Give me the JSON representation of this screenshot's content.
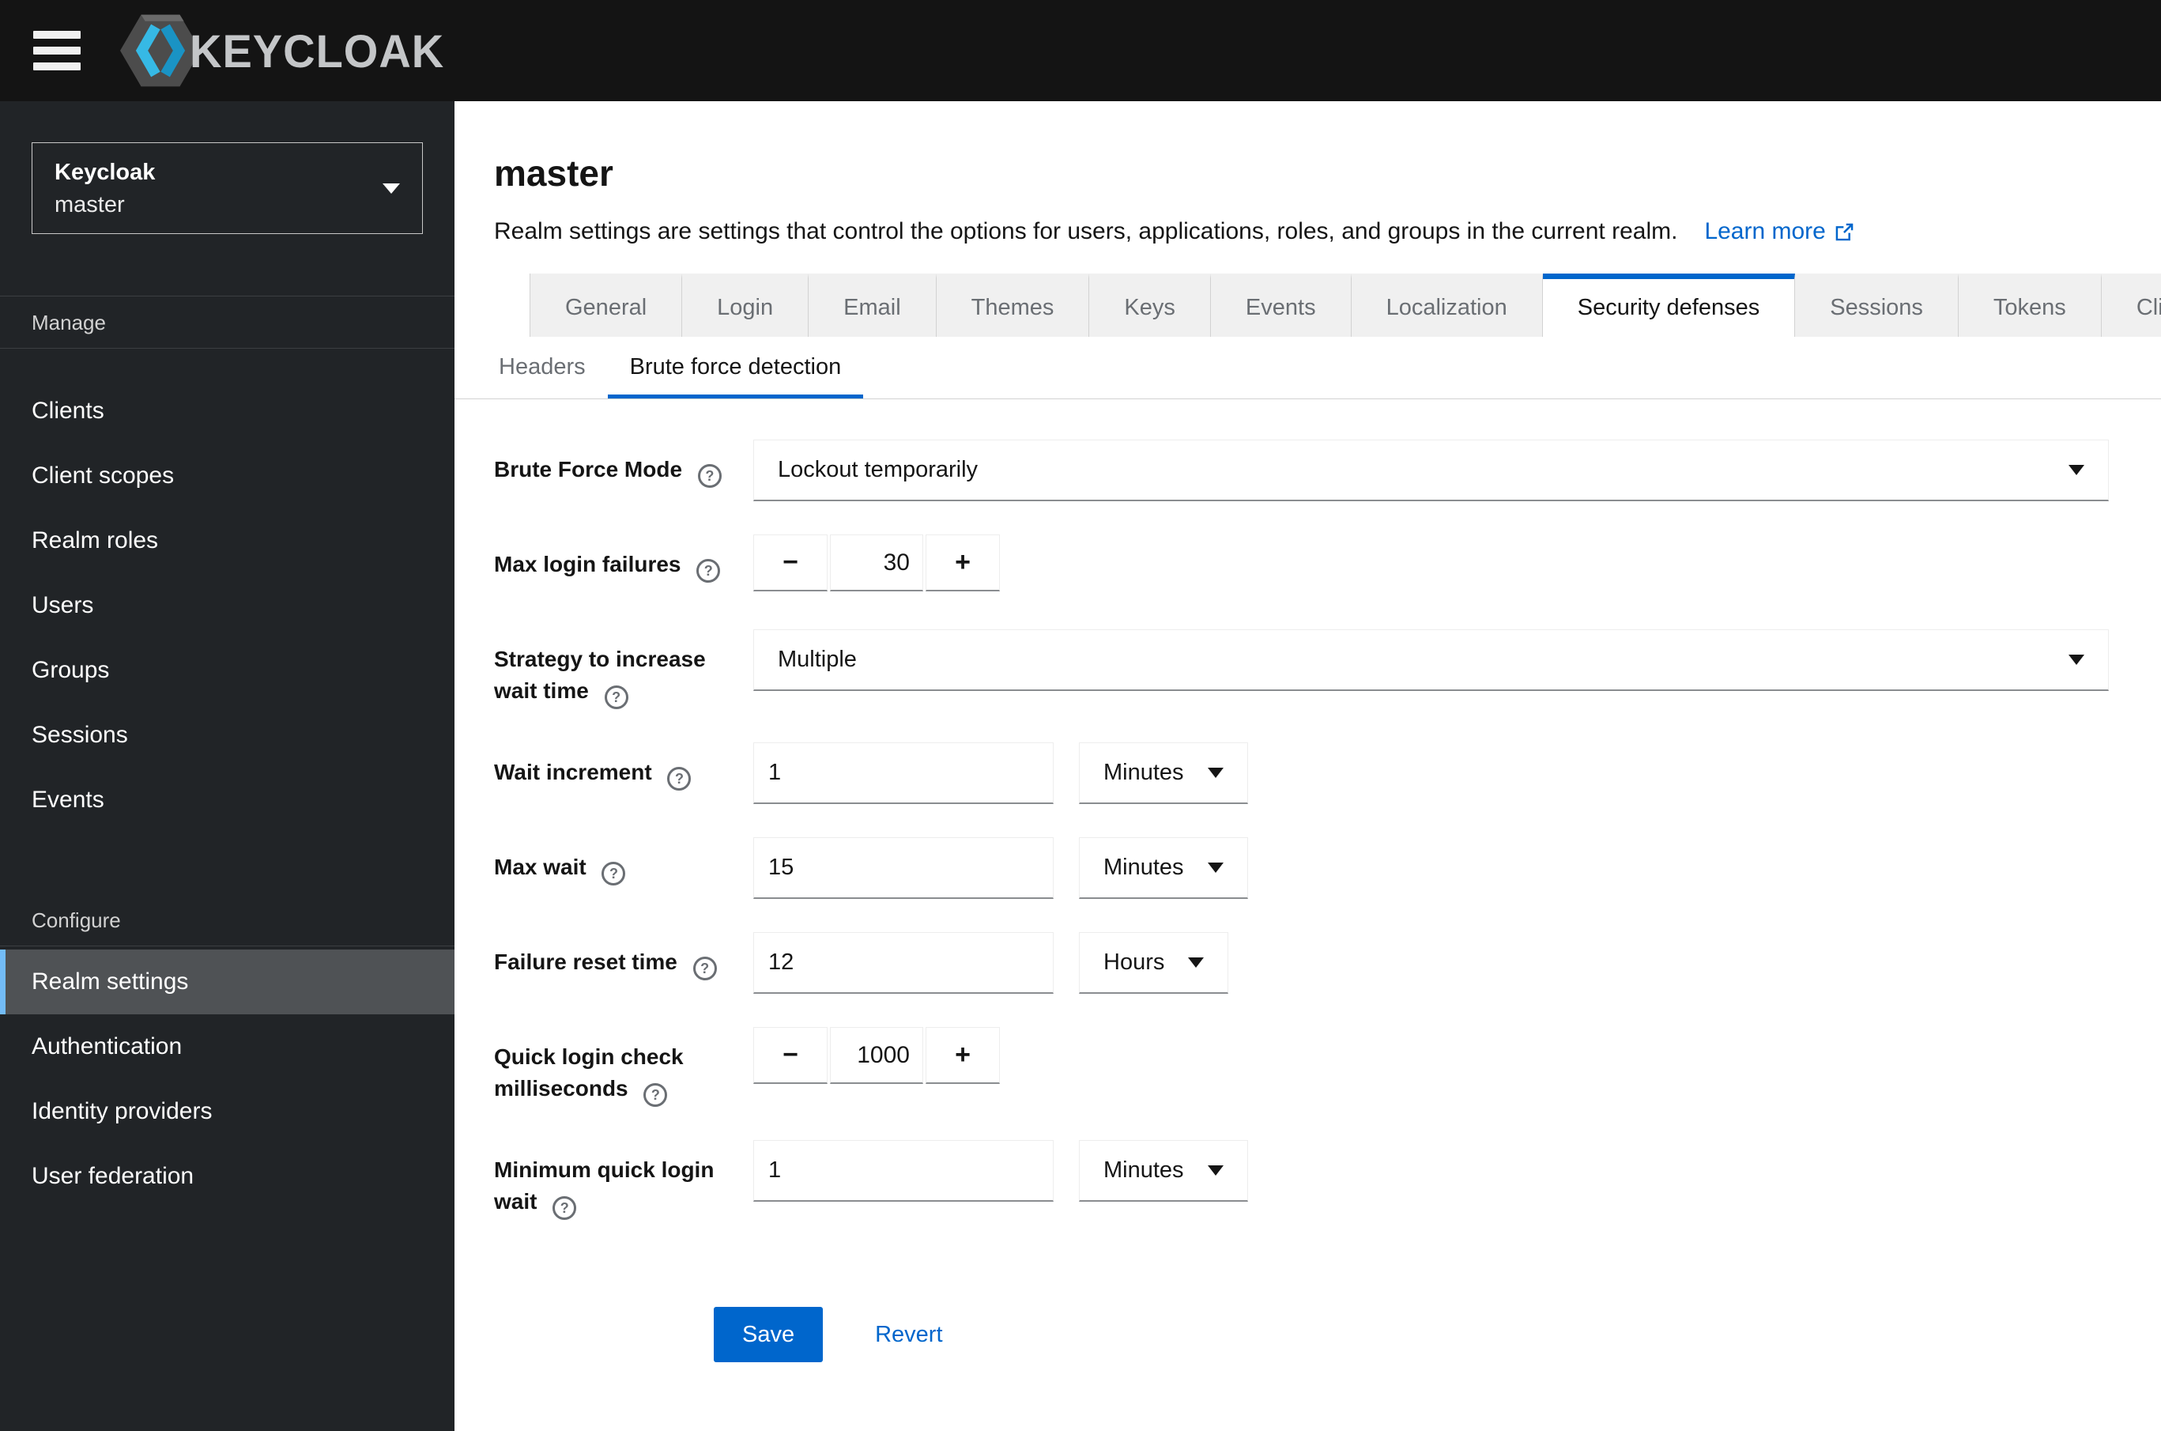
{
  "topbar": {
    "brand": "KEYCLOAK"
  },
  "sidebar": {
    "realm_selector": {
      "name": "Keycloak",
      "realm": "master"
    },
    "sections": [
      {
        "title": "Manage",
        "items": [
          {
            "label": "Clients",
            "selected": false
          },
          {
            "label": "Client scopes",
            "selected": false
          },
          {
            "label": "Realm roles",
            "selected": false
          },
          {
            "label": "Users",
            "selected": false
          },
          {
            "label": "Groups",
            "selected": false
          },
          {
            "label": "Sessions",
            "selected": false
          },
          {
            "label": "Events",
            "selected": false
          }
        ]
      },
      {
        "title": "Configure",
        "items": [
          {
            "label": "Realm settings",
            "selected": true
          },
          {
            "label": "Authentication",
            "selected": false
          },
          {
            "label": "Identity providers",
            "selected": false
          },
          {
            "label": "User federation",
            "selected": false
          }
        ]
      }
    ]
  },
  "page": {
    "title": "master",
    "description": "Realm settings are settings that control the options for users, applications, roles, and groups in the current realm.",
    "learn_more_label": "Learn more"
  },
  "tabs": [
    {
      "label": "General",
      "active": false
    },
    {
      "label": "Login",
      "active": false
    },
    {
      "label": "Email",
      "active": false
    },
    {
      "label": "Themes",
      "active": false
    },
    {
      "label": "Keys",
      "active": false
    },
    {
      "label": "Events",
      "active": false
    },
    {
      "label": "Localization",
      "active": false
    },
    {
      "label": "Security defenses",
      "active": true
    },
    {
      "label": "Sessions",
      "active": false
    },
    {
      "label": "Tokens",
      "active": false
    },
    {
      "label": "Client policies",
      "active": false
    }
  ],
  "subtabs": [
    {
      "label": "Headers",
      "active": false
    },
    {
      "label": "Brute force detection",
      "active": true
    }
  ],
  "form": {
    "help_glyph": "?",
    "stepper_minus": "−",
    "stepper_plus": "+",
    "fields": [
      {
        "id": "brute-force-mode",
        "label": "Brute Force Mode",
        "control": "select",
        "value": "Lockout temporarily"
      },
      {
        "id": "max-login-failures",
        "label": "Max login failures",
        "control": "stepper",
        "value": "30"
      },
      {
        "id": "strategy-to-increase-wait-time",
        "label": "Strategy to increase wait time",
        "control": "select",
        "value": "Multiple"
      },
      {
        "id": "wait-increment",
        "label": "Wait increment",
        "control": "input-unit",
        "value": "1",
        "unit": "Minutes"
      },
      {
        "id": "max-wait",
        "label": "Max wait",
        "control": "input-unit",
        "value": "15",
        "unit": "Minutes"
      },
      {
        "id": "failure-reset-time",
        "label": "Failure reset time",
        "control": "input-unit",
        "value": "12",
        "unit": "Hours"
      },
      {
        "id": "quick-login-check-milliseconds",
        "label": "Quick login check milliseconds",
        "control": "stepper",
        "value": "1000"
      },
      {
        "id": "minimum-quick-login-wait",
        "label": "Minimum quick login wait",
        "control": "input-unit",
        "value": "1",
        "unit": "Minutes"
      }
    ]
  },
  "actions": {
    "save": "Save",
    "revert": "Revert"
  },
  "colors": {
    "topbar_bg": "#141414",
    "sidebar_bg": "#212427",
    "sidebar_selected_bg": "#4f5255",
    "sidebar_selected_accent": "#73bcf7",
    "accent_blue": "#0066cc",
    "tab_bg": "#f0f0f0",
    "muted_text": "#6a6e73",
    "control_bottom_border": "#8a8d90"
  }
}
